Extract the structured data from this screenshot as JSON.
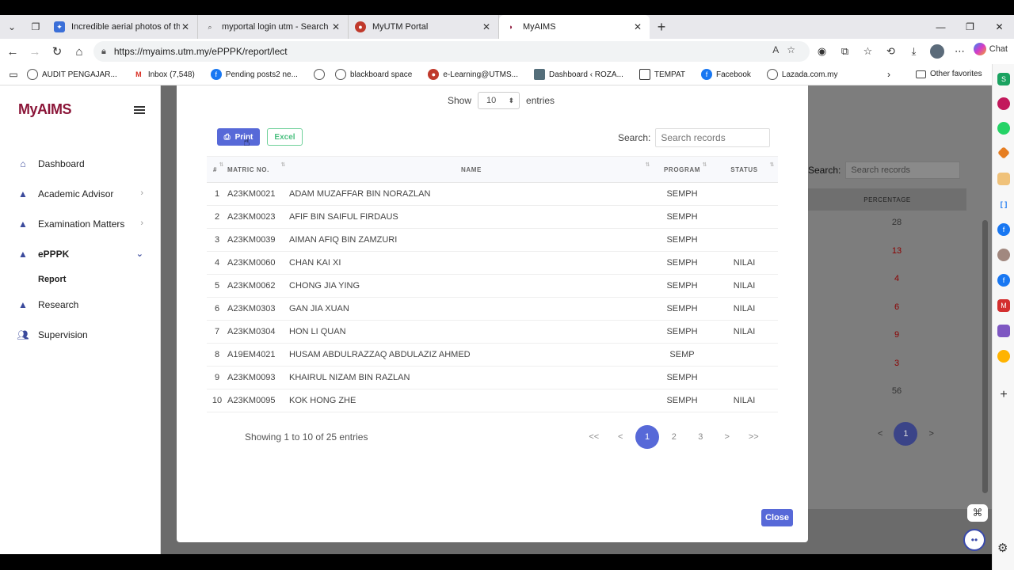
{
  "browser": {
    "tabs": [
      {
        "title": "Incredible aerial photos of the wor",
        "icon": "butterfly-icon",
        "color": "#3b6fd8"
      },
      {
        "title": "myportal login utm - Search",
        "icon": "search-icon",
        "color": "#444444"
      },
      {
        "title": "MyUTM Portal",
        "icon": "utm-logo-icon",
        "color": "#c0392b"
      },
      {
        "title": "MyAIMS",
        "icon": "myaims-logo-icon",
        "color": "#8b1538"
      }
    ],
    "url": "https://myaims.utm.my/ePPPK/report/lect",
    "chat_label": "Chat",
    "bookmarks": [
      {
        "label": "AUDIT PENGAJAR...",
        "icon": "globe-icon"
      },
      {
        "label": "Inbox (7,548)",
        "icon": "gmail-icon"
      },
      {
        "label": "Pending posts2 ne...",
        "icon": "facebook-icon"
      },
      {
        "label": "",
        "icon": "globe-icon"
      },
      {
        "label": "blackboard space",
        "icon": "globe-icon"
      },
      {
        "label": "e-Learning@UTMS...",
        "icon": "utm-logo-icon"
      },
      {
        "label": "Dashboard ‹ ROZA...",
        "icon": "site-icon"
      },
      {
        "label": "TEMPAT",
        "icon": "calendar-icon"
      },
      {
        "label": "Facebook",
        "icon": "facebook-icon"
      },
      {
        "label": "Lazada.com.my",
        "icon": "globe-icon"
      }
    ],
    "other_favorites": "Other favorites"
  },
  "sidebar": {
    "logo": "MyAIMS",
    "items": [
      {
        "label": "Dashboard",
        "icon": "home-icon",
        "chevron": false
      },
      {
        "label": "Academic Advisor",
        "icon": "graduation-cap-icon",
        "chevron": true
      },
      {
        "label": "Examination Matters",
        "icon": "graduation-cap-icon",
        "chevron": true
      },
      {
        "label": "ePPPK",
        "icon": "graduation-cap-icon",
        "chevron": true,
        "open": true
      }
    ],
    "sub_item": "Report",
    "items_after": [
      {
        "label": "Research",
        "icon": "graduation-cap-icon"
      },
      {
        "label": "Supervision",
        "icon": "users-icon"
      }
    ]
  },
  "background": {
    "search_label": "Search:",
    "search_placeholder": "Search records",
    "column": "PERCENTAGE",
    "values": [
      {
        "v": "28",
        "color": "#333333"
      },
      {
        "v": "13",
        "color": "#8b0000"
      },
      {
        "v": "4",
        "color": "#8b0000"
      },
      {
        "v": "6",
        "color": "#8b0000"
      },
      {
        "v": "9",
        "color": "#8b0000"
      },
      {
        "v": "3",
        "color": "#8b0000"
      },
      {
        "v": "56",
        "color": "#333333"
      }
    ],
    "pager_prev": "<",
    "pager_current": "1",
    "pager_next": ">"
  },
  "modal": {
    "show_label": "Show",
    "show_value": "10",
    "entries_label": "entries",
    "print_label": "Print",
    "excel_label": "Excel",
    "search_label": "Search:",
    "search_placeholder": "Search records",
    "columns": [
      "#",
      "MATRIC NO.",
      "NAME",
      "PROGRAM",
      "STATUS"
    ],
    "rows": [
      {
        "no": "1",
        "matric": "A23KM0021",
        "name": "ADAM MUZAFFAR BIN NORAZLAN",
        "program": "SEMPH",
        "status": ""
      },
      {
        "no": "2",
        "matric": "A23KM0023",
        "name": "AFIF BIN SAIFUL FIRDAUS",
        "program": "SEMPH",
        "status": ""
      },
      {
        "no": "3",
        "matric": "A23KM0039",
        "name": "AIMAN AFIQ BIN ZAMZURI",
        "program": "SEMPH",
        "status": ""
      },
      {
        "no": "4",
        "matric": "A23KM0060",
        "name": "CHAN KAI XI",
        "program": "SEMPH",
        "status": "NILAI"
      },
      {
        "no": "5",
        "matric": "A23KM0062",
        "name": "CHONG JIA YING",
        "program": "SEMPH",
        "status": "NILAI"
      },
      {
        "no": "6",
        "matric": "A23KM0303",
        "name": "GAN JIA XUAN",
        "program": "SEMPH",
        "status": "NILAI"
      },
      {
        "no": "7",
        "matric": "A23KM0304",
        "name": "HON LI QUAN",
        "program": "SEMPH",
        "status": "NILAI"
      },
      {
        "no": "8",
        "matric": "A19EM4021",
        "name": "HUSAM ABDULRAZZAQ ABDULAZIZ AHMED",
        "program": "SEMP",
        "status": ""
      },
      {
        "no": "9",
        "matric": "A23KM0093",
        "name": "KHAIRUL NIZAM BIN RAZLAN",
        "program": "SEMPH",
        "status": ""
      },
      {
        "no": "10",
        "matric": "A23KM0095",
        "name": "KOK HONG ZHE",
        "program": "SEMPH",
        "status": "NILAI"
      }
    ],
    "info": "Showing 1 to 10 of 25 entries",
    "pager": [
      "<<",
      "<",
      "1",
      "2",
      "3",
      ">",
      ">>"
    ],
    "pager_current": "1",
    "close_label": "Close"
  },
  "colors": {
    "accent": "#5769d8",
    "brand": "#8b1538",
    "excel": "#4cc080"
  }
}
